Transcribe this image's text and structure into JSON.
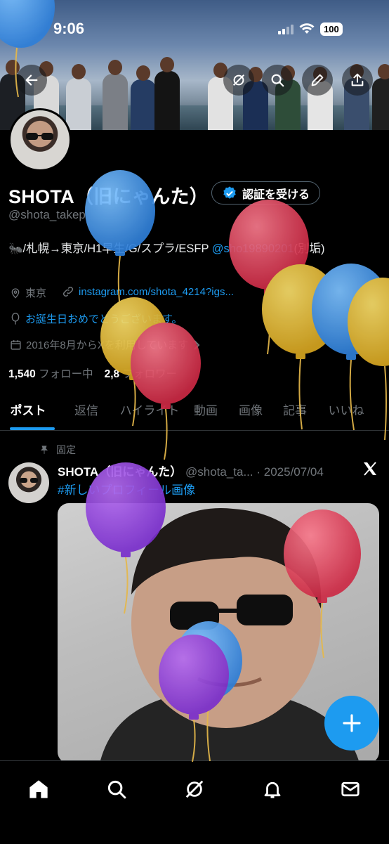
{
  "status_bar": {
    "time": "9:06",
    "battery": "100"
  },
  "profile": {
    "name": "SHOTA（旧にゃんた）",
    "verify_label": "認証を受ける",
    "handle": "@shota_takep",
    "bio_text": "🐜/札幌→東京/H1早生/G/スプラ/ESFP ",
    "bio_mention": "@sho19890201",
    "bio_suffix": "(別垢)",
    "location": "東京",
    "link": "instagram.com/shota_4214?igs...",
    "birthday": "お誕生日おめでとうございます。",
    "joined": "2016年8月からXを利用しています",
    "following_count": "1,540",
    "following_label": "フォロー中",
    "followers_count": "2,8",
    "followers_label": "フォロワー"
  },
  "tabs": [
    "ポスト",
    "返信",
    "ハイライト",
    "動画",
    "画像",
    "記事",
    "いいね"
  ],
  "post": {
    "pinned_label": "固定",
    "author_name": "SHOTA（旧にゃんた）",
    "author_handle": "@shota_ta...",
    "date": "· 2025/07/04",
    "hashtag": "#新しいプロフィール画像"
  },
  "icons": {
    "back": "back-arrow-icon",
    "grok": "grok-icon",
    "search": "search-icon",
    "edit": "pencil-icon",
    "share": "share-icon",
    "verified": "verified-badge-icon",
    "fab": "plus-icon"
  },
  "colors": {
    "accent": "#1d9bf0",
    "background": "#000000",
    "muted": "#71767b"
  }
}
